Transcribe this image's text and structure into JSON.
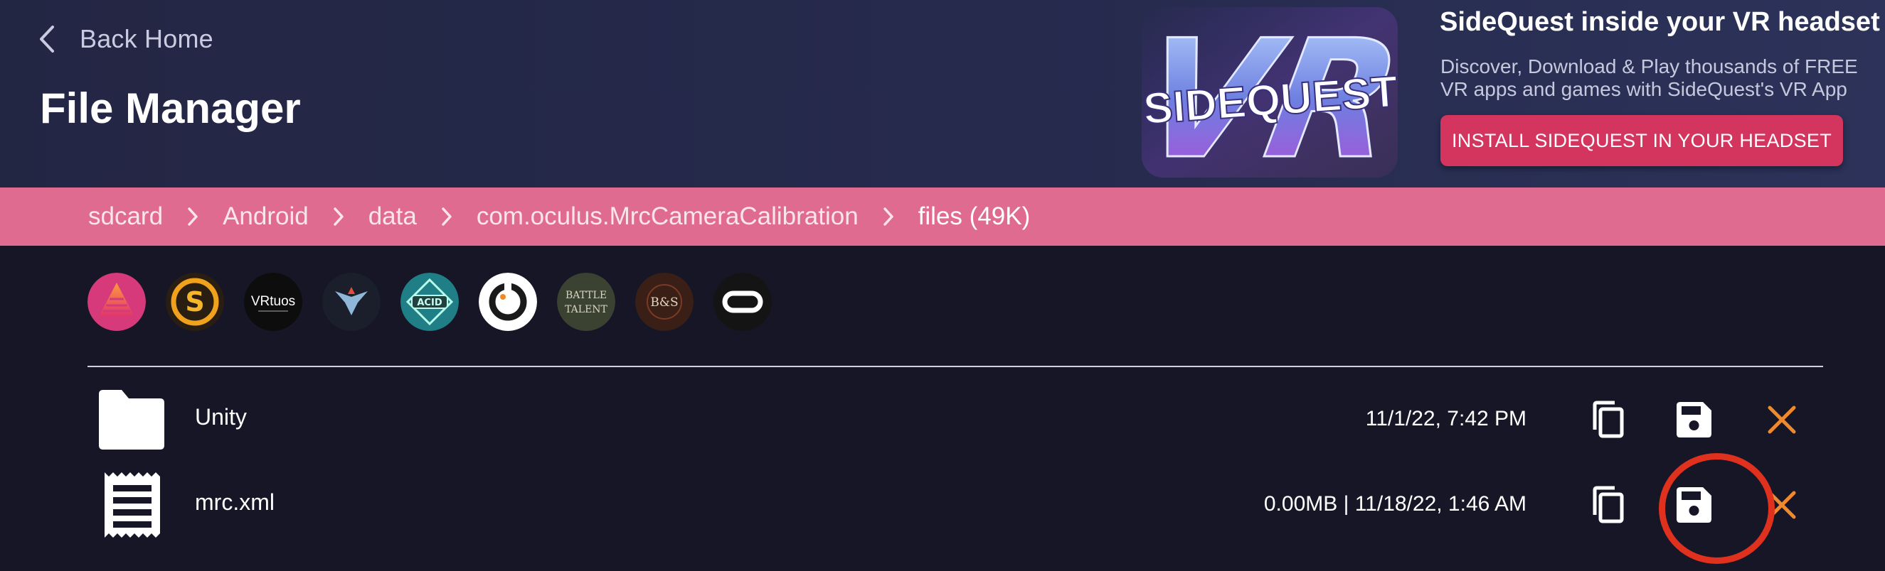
{
  "header": {
    "back_label": "Back Home",
    "title": "File Manager"
  },
  "promo": {
    "art_text": "SIDEQUEST",
    "art_letters": "VR",
    "heading": "SideQuest inside your VR headset",
    "description": "Discover, Download & Play thousands of FREE VR apps and games with SideQuest's VR App",
    "button_label": "INSTALL SIDEQUEST IN YOUR HEADSET"
  },
  "breadcrumb": {
    "items": [
      "sdcard",
      "Android",
      "data",
      "com.oculus.MrcCameraCalibration",
      "files (49K)"
    ]
  },
  "apps": {
    "vrtuos_label": "VRtuos",
    "battle_label_1": "BATTLE",
    "battle_label_2": "TALENT",
    "bs_label": "B&S",
    "acid_label": "ACID"
  },
  "files": [
    {
      "name": "Unity",
      "meta": "11/1/22, 7:42 PM",
      "type": "folder"
    },
    {
      "name": "mrc.xml",
      "meta": "0.00MB | 11/18/22, 1:46 AM",
      "type": "file"
    }
  ],
  "colors": {
    "header_bg": "#262a4d",
    "breadcrumb_bg": "#e06b91",
    "page_bg": "#161626",
    "accent_button": "#d3355e",
    "delete_icon": "#f0892b",
    "highlight_ring": "#e0301e"
  }
}
